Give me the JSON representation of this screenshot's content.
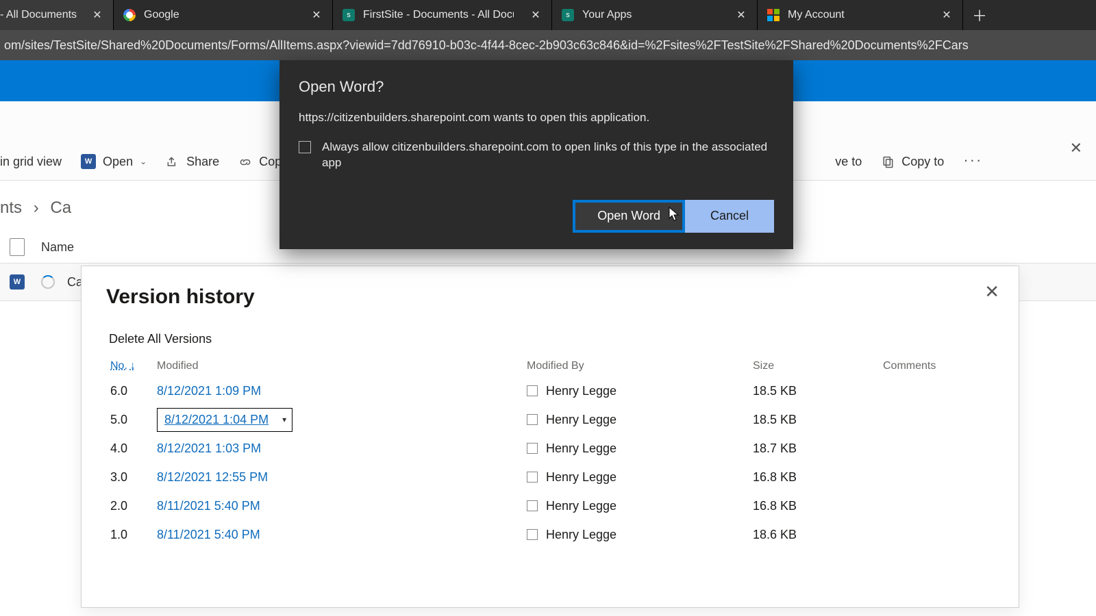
{
  "tabs": [
    {
      "title": "- All Documents"
    },
    {
      "title": "Google"
    },
    {
      "title": "FirstSite - Documents - All Docum"
    },
    {
      "title": "Your Apps"
    },
    {
      "title": "My Account"
    }
  ],
  "url": "om/sites/TestSite/Shared%20Documents/Forms/AllItems.aspx?viewid=7dd76910-b03c-4f44-8cec-2b903c63c846&id=%2Fsites%2FTestSite%2FShared%20Documents%2FCars",
  "toolbar": {
    "gridview": "in grid view",
    "open": "Open",
    "share": "Share",
    "copy": "Cop",
    "veto": "ve to",
    "copyto": "Copy to",
    "dots": "···"
  },
  "breadcrumb": {
    "a": "nts",
    "sep": "›",
    "b": "Ca"
  },
  "listhead": {
    "name": "Name"
  },
  "listrow": {
    "name": "Car typ"
  },
  "modal": {
    "title": "Open Word?",
    "msg": "https://citizenbuilders.sharepoint.com wants to open this application.",
    "always": "Always allow citizenbuilders.sharepoint.com to open links of this type in the associated app",
    "open": "Open Word",
    "cancel": "Cancel"
  },
  "vh": {
    "title": "Version history",
    "delall": "Delete All Versions",
    "cols": {
      "no": "No.",
      "modified": "Modified",
      "modifiedby": "Modified By",
      "size": "Size",
      "comments": "Comments"
    },
    "rows": [
      {
        "n": "6.0",
        "d": "8/12/2021 1:09 PM",
        "by": "Henry Legge",
        "size": "18.5 KB",
        "sel": false
      },
      {
        "n": "5.0",
        "d": "8/12/2021 1:04 PM",
        "by": "Henry Legge",
        "size": "18.5 KB",
        "sel": true
      },
      {
        "n": "4.0",
        "d": "8/12/2021 1:03 PM",
        "by": "Henry Legge",
        "size": "18.7 KB",
        "sel": false
      },
      {
        "n": "3.0",
        "d": "8/12/2021 12:55 PM",
        "by": "Henry Legge",
        "size": "16.8 KB",
        "sel": false
      },
      {
        "n": "2.0",
        "d": "8/11/2021 5:40 PM",
        "by": "Henry Legge",
        "size": "16.8 KB",
        "sel": false
      },
      {
        "n": "1.0",
        "d": "8/11/2021 5:40 PM",
        "by": "Henry Legge",
        "size": "18.6 KB",
        "sel": false
      }
    ]
  }
}
